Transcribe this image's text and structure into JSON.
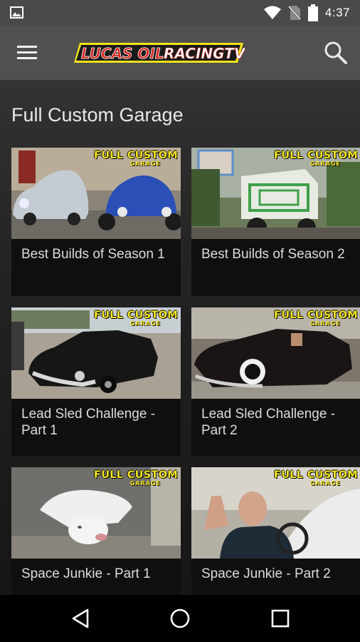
{
  "status_bar": {
    "time": "4:37",
    "icons": [
      "image-icon",
      "wifi-icon",
      "no-sim-icon",
      "battery-icon"
    ]
  },
  "app_bar": {
    "logo_text_1": "LUCAS OIL",
    "logo_text_2": "RACINGTV",
    "icons": [
      "menu-icon",
      "search-icon"
    ]
  },
  "section": {
    "title": "Full Custom Garage"
  },
  "badge": {
    "line1": "FULL CUSTOM",
    "line2": "GARAGE"
  },
  "videos": [
    {
      "title": "Best Builds of Season 1"
    },
    {
      "title": "Best Builds of Season 2"
    },
    {
      "title": "Lead Sled Challenge - Part 1"
    },
    {
      "title": "Lead Sled Challenge - Part 2"
    },
    {
      "title": "Space Junkie - Part 1"
    },
    {
      "title": "Space Junkie - Part 2"
    }
  ],
  "nav": {
    "icons": [
      "back-icon",
      "home-icon",
      "recents-icon"
    ]
  },
  "colors": {
    "status_bar": "#4a4a4a",
    "app_bar": "#505050",
    "badge_yellow": "#f5e623",
    "logo_red": "#d8231c",
    "logo_yellow": "#f3e21a"
  }
}
